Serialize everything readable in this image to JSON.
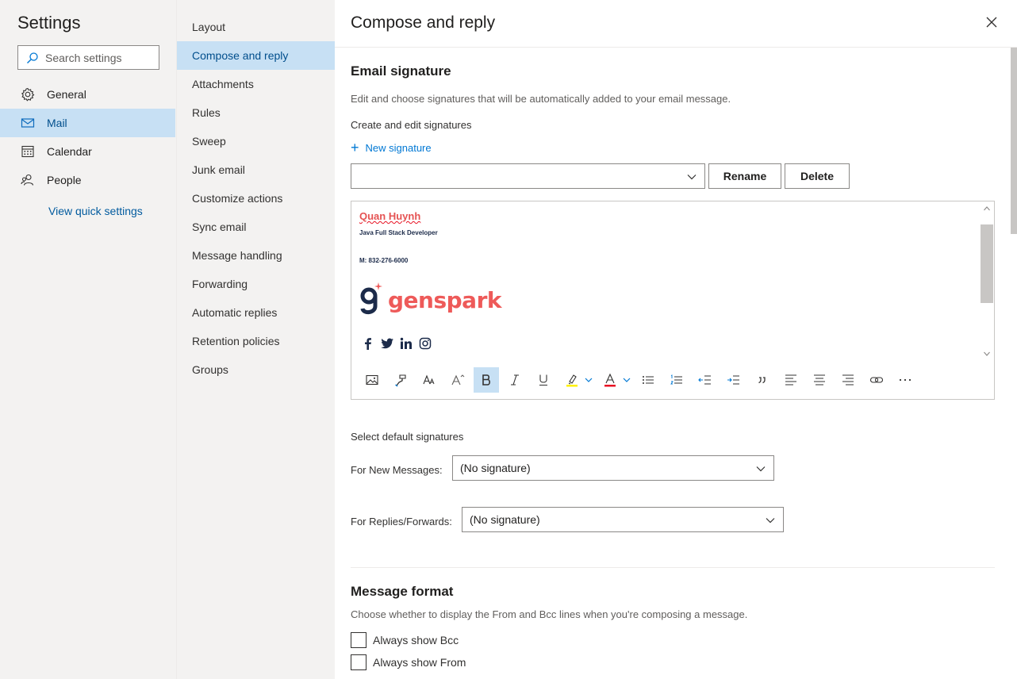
{
  "settings": {
    "title": "Settings",
    "search_placeholder": "Search settings",
    "nav": [
      {
        "label": "General",
        "icon": "gear-icon"
      },
      {
        "label": "Mail",
        "icon": "mail-icon"
      },
      {
        "label": "Calendar",
        "icon": "calendar-icon"
      },
      {
        "label": "People",
        "icon": "people-icon"
      }
    ],
    "active_nav": "Mail",
    "quick_settings_link": "View quick settings"
  },
  "mail_sections": {
    "items": [
      "Layout",
      "Compose and reply",
      "Attachments",
      "Rules",
      "Sweep",
      "Junk email",
      "Customize actions",
      "Sync email",
      "Message handling",
      "Forwarding",
      "Automatic replies",
      "Retention policies",
      "Groups"
    ],
    "active": "Compose and reply"
  },
  "content": {
    "title": "Compose and reply",
    "email_signature": {
      "heading": "Email signature",
      "description": "Edit and choose signatures that will be automatically added to your email message.",
      "create_label": "Create and edit signatures",
      "new_signature": "New signature",
      "selected_signature": "",
      "rename": "Rename",
      "delete": "Delete"
    },
    "signature_body": {
      "name": "Quan Huynh",
      "role": "Java Full Stack Developer",
      "phone": "M: 832-276-6000",
      "logo_text": "genspark",
      "social_icons": [
        "facebook-icon",
        "twitter-icon",
        "linkedin-icon",
        "instagram-icon"
      ]
    },
    "toolbar": [
      "image-icon",
      "format-painter-icon",
      "font-size-icon",
      "grow-font-icon",
      "bold-icon",
      "italic-icon",
      "underline-icon",
      "highlight-icon",
      "font-color-icon",
      "bullets-icon",
      "numbering-icon",
      "decrease-indent-icon",
      "increase-indent-icon",
      "quote-icon",
      "align-left-icon",
      "align-center-icon",
      "align-right-icon",
      "link-icon",
      "more-icon"
    ],
    "default_signatures": {
      "heading": "Select default signatures",
      "new_messages_label": "For New Messages:",
      "new_messages_value": "(No signature)",
      "replies_label": "For Replies/Forwards:",
      "replies_value": "(No signature)"
    },
    "message_format": {
      "heading": "Message format",
      "description": "Choose whether to display the From and Bcc lines when you're composing a message.",
      "always_bcc": "Always show Bcc",
      "always_from": "Always show From"
    }
  },
  "colors": {
    "accent": "#0078d4",
    "selected_bg": "#c7e0f4",
    "pane_bg": "#f3f2f1",
    "signature_red": "#ee5a59",
    "signature_navy": "#1c2b4a"
  }
}
